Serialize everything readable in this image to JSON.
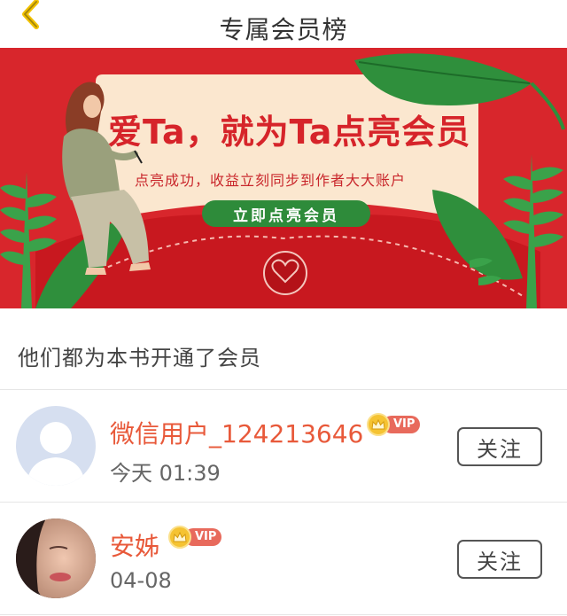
{
  "header": {
    "title": "专属会员榜",
    "back_icon": "chevron-left-icon"
  },
  "banner": {
    "headline": "爱Ta，就为Ta点亮会员",
    "subtitle": "点亮成功，收益立刻同步到作者大大账户",
    "cta_label": "立即点亮会员",
    "colors": {
      "background": "#d8262c",
      "card": "#fbe7cf",
      "leaf": "#2f8f3c",
      "cta": "#2e8b3a"
    }
  },
  "section": {
    "title": "他们都为本书开通了会员"
  },
  "members": [
    {
      "name": "微信用户_124213646",
      "badge": "VIP",
      "time": "今天 01:39",
      "follow_label": "关注",
      "avatar": "default-avatar-icon"
    },
    {
      "name": "安姊",
      "badge": "VIP",
      "time": "04-08",
      "follow_label": "关注",
      "avatar": "user-photo-avatar"
    }
  ],
  "colors": {
    "name": "#e8593a",
    "vip_pill": "#e86a5c",
    "vip_crown": "#f5c332",
    "back_arrow": "#f2c200"
  }
}
